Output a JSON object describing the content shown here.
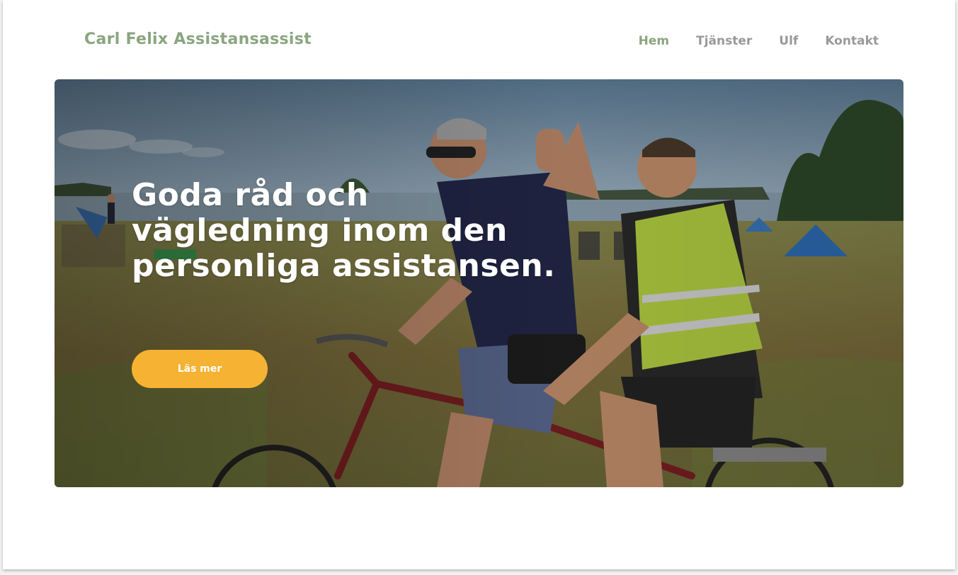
{
  "header": {
    "brand": "Carl Felix Assistansassist",
    "nav": [
      {
        "label": "Hem",
        "active": true
      },
      {
        "label": "Tjänster",
        "active": false
      },
      {
        "label": "Ulf",
        "active": false
      },
      {
        "label": "Kontakt",
        "active": false
      }
    ]
  },
  "hero": {
    "title": "Goda råd och vägledning inom den personliga assistansen.",
    "button_label": "Läs mer",
    "image_description": "hero-photo-tandem-bicycle-beach"
  },
  "colors": {
    "brand_green": "#8aa580",
    "nav_gray": "#999999",
    "button_orange": "#f6b232",
    "hero_text": "#ffffff"
  }
}
